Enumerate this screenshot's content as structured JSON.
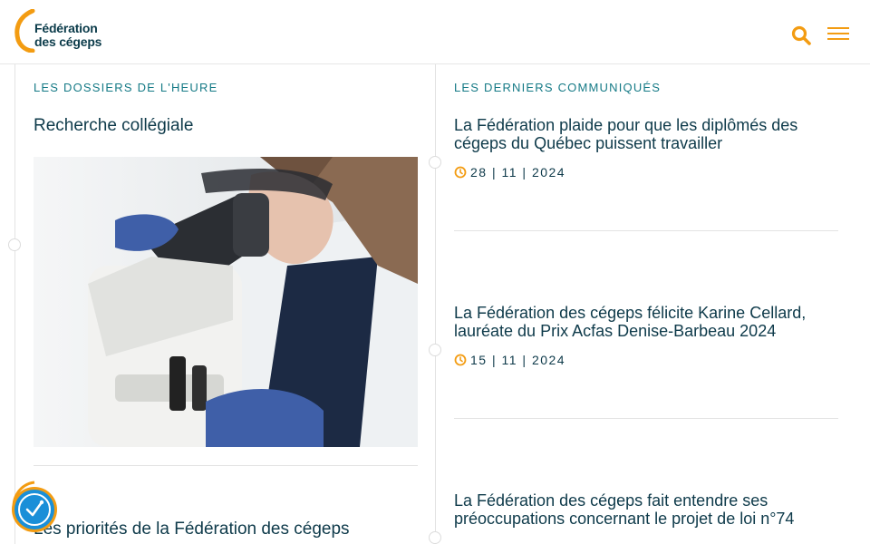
{
  "header": {
    "logo_line1": "Fédération",
    "logo_line2": "des cégeps",
    "search_icon": "search-icon",
    "menu_icon": "hamburger-menu-icon"
  },
  "left": {
    "section_label": "LES DOSSIERS DE L'HEURE",
    "dossiers": [
      {
        "title": "Recherche collégiale"
      },
      {
        "title": "Les priorités de la Fédération des cégeps"
      }
    ]
  },
  "right": {
    "section_label": "LES DERNIERS COMMUNIQUÉS",
    "news": [
      {
        "title": "La Fédération plaide pour que les diplômés des cégeps du Québec puissent travailler",
        "date": "28 | 11 | 2024"
      },
      {
        "title": "La Fédération des cégeps félicite Karine Cellard, lauréate du Prix Acfas Denise-Barbeau 2024",
        "date": "15 | 11 | 2024"
      },
      {
        "title": "La Fédération des cégeps fait entendre ses préoccupations concernant le projet de loi n°74",
        "date": ""
      }
    ]
  },
  "colors": {
    "brand_orange": "#f39c12",
    "brand_navy": "#0e3a4a",
    "accent_teal": "#157a86",
    "a11y_blue": "#1a8fd8"
  }
}
